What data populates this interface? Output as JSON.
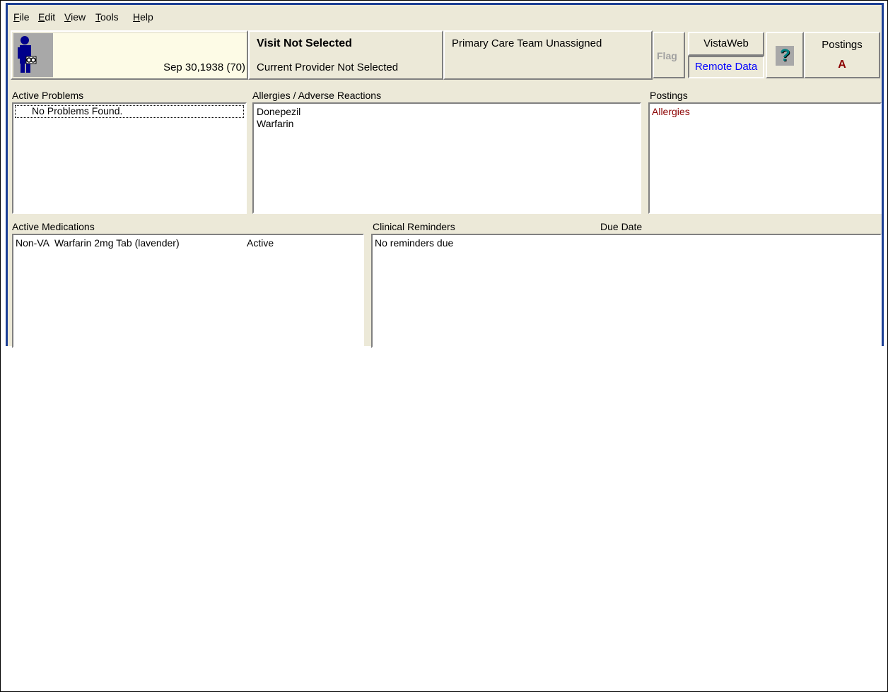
{
  "menu": {
    "items": [
      {
        "label": "File",
        "accel": "F",
        "rest": "ile"
      },
      {
        "label": "Edit",
        "accel": "E",
        "rest": "dit"
      },
      {
        "label": "View",
        "accel": "V",
        "rest": "iew"
      },
      {
        "label": "Tools",
        "accel": "T",
        "rest": "ools"
      },
      {
        "label": "Help",
        "accel": "H",
        "rest": "elp"
      }
    ]
  },
  "header": {
    "patient_dob": "Sep 30,1938 (70)",
    "visit_title": "Visit Not Selected",
    "provider": "Current Provider Not Selected",
    "care_team": "Primary Care Team Unassigned",
    "flag_label": "Flag",
    "vistaweb_label": "VistaWeb",
    "remote_data_label": "Remote Data",
    "help_glyph": "?",
    "postings_label": "Postings",
    "postings_code": "A"
  },
  "problems": {
    "title": "Active Problems",
    "items": [
      "No Problems Found."
    ]
  },
  "allergies": {
    "title": "Allergies / Adverse Reactions",
    "items": [
      "Donepezil",
      "Warfarin"
    ]
  },
  "postings": {
    "title": "Postings",
    "items": [
      "Allergies"
    ]
  },
  "medications": {
    "title": "Active Medications",
    "items": [
      {
        "name": "Non-VA  Warfarin 2mg Tab (lavender)",
        "status": "Active"
      }
    ]
  },
  "reminders": {
    "title": "Clinical Reminders",
    "due_title": "Due Date",
    "items": [
      "No reminders due"
    ]
  },
  "colors": {
    "window_bg": "#ece9d8",
    "frame_blue": "#1c3f94",
    "link_blue": "#0000ff",
    "posting_red": "#8b0000",
    "flag_gray": "#a0a0a0"
  },
  "icons": [
    "patient-icon",
    "help-icon"
  ]
}
